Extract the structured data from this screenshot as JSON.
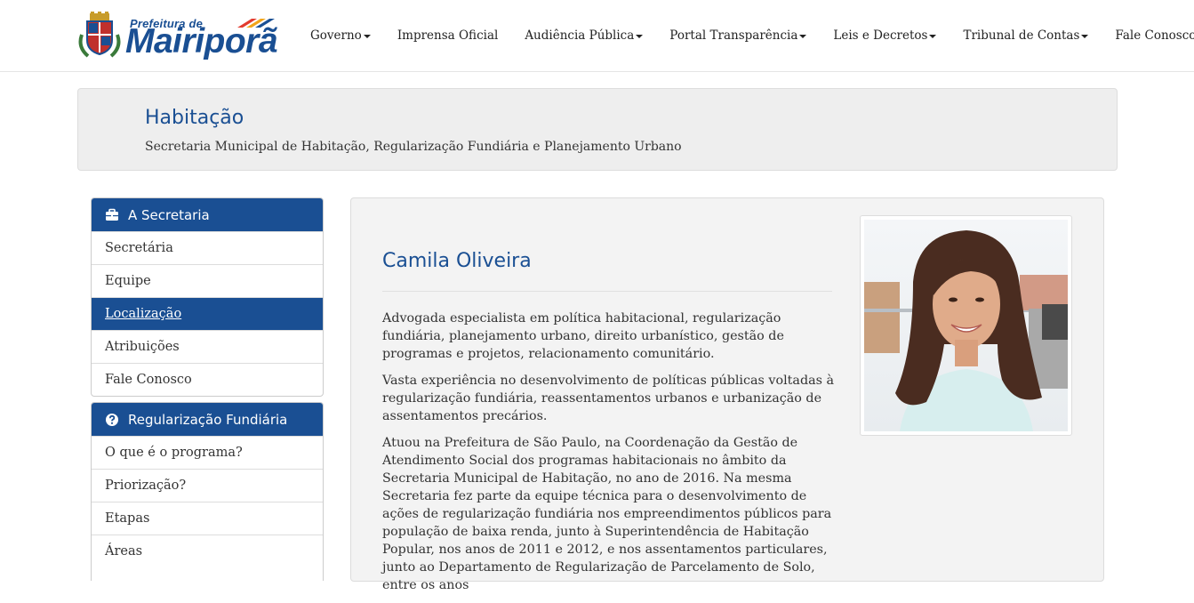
{
  "header": {
    "logo": {
      "top_text": "Prefeitura de",
      "main_text": "Mairiporã"
    },
    "nav": [
      {
        "label": "Governo",
        "dropdown": true
      },
      {
        "label": "Imprensa Oficial",
        "dropdown": false
      },
      {
        "label": "Audiência Pública",
        "dropdown": true
      },
      {
        "label": "Portal Transparência",
        "dropdown": true
      },
      {
        "label": "Leis e Decretos",
        "dropdown": true
      },
      {
        "label": "Tribunal de Contas",
        "dropdown": true
      },
      {
        "label": "Fale Conosco",
        "dropdown": false
      }
    ]
  },
  "page": {
    "title": "Habitação",
    "subtitle": "Secretaria Municipal de Habitação, Regularização Fundiária e Planejamento Urbano"
  },
  "sidebar": {
    "sections": [
      {
        "title": "A Secretaria",
        "icon": "briefcase-icon",
        "items": [
          "Secretária",
          "Equipe",
          "Localização",
          "Atribuições",
          "Fale Conosco"
        ],
        "active_item": "Localização"
      },
      {
        "title": "Regularização Fundiária",
        "icon": "question-circle-icon",
        "items": [
          "O que é o programa?",
          "Priorização?",
          "Etapas",
          "Áreas"
        ]
      }
    ]
  },
  "content": {
    "name": "Camila Oliveira",
    "paragraphs": [
      "Advogada especialista em política habitacional, regularização fundiária, planejamento urbano, direito urbanístico, gestão de programas e projetos, relacionamento comunitário.",
      "Vasta experiência no desenvolvimento de políticas públicas voltadas à regularização fundiária, reassentamentos urbanos e urbanização de assentamentos precários.",
      "Atuou na Prefeitura de São Paulo, na Coordenação da Gestão de Atendimento Social dos programas habitacionais no âmbito da Secretaria Municipal de Habitação, no ano de 2016. Na mesma Secretaria fez parte da equipe técnica para o desenvolvimento de ações de regularização fundiária nos empreendimentos públicos para população de baixa renda, junto à Superintendência de Habitação Popular, nos anos de 2011 e 2012, e nos assentamentos particulares, junto ao Departamento de Regularização de Parcelamento de Solo, entre os anos"
    ]
  },
  "colors": {
    "primary": "#1a4f93",
    "header_bg": "#eeeeee",
    "content_bg": "#f3f3f3"
  }
}
